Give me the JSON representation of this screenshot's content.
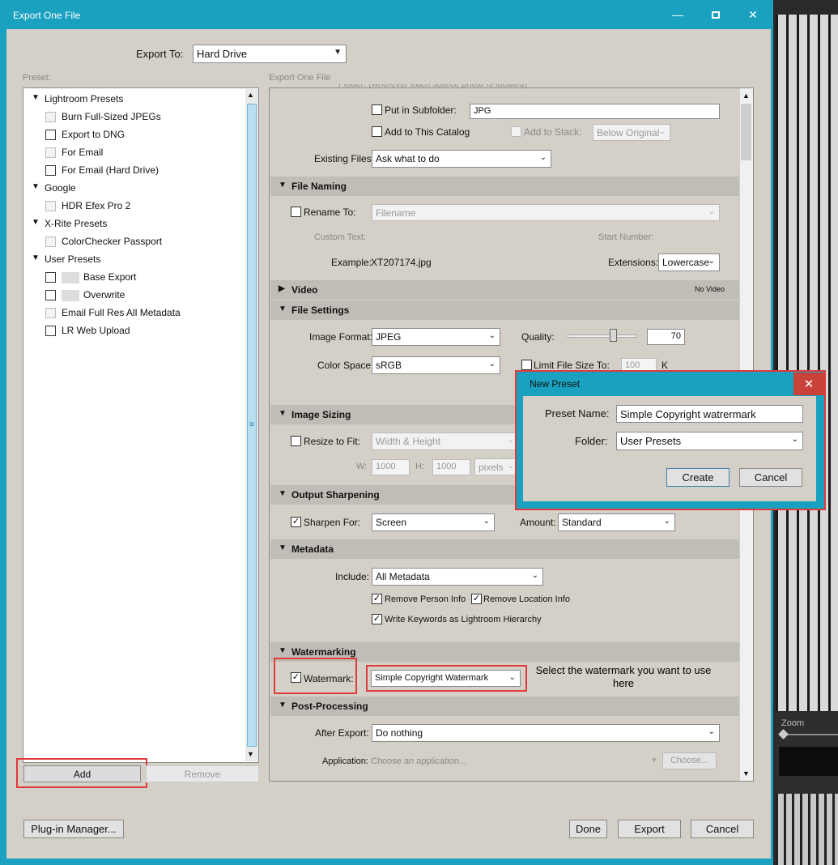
{
  "window": {
    "title": "Export One File"
  },
  "export_to": {
    "label": "Export To:",
    "value": "Hard Drive"
  },
  "preset": {
    "label": "Preset:"
  },
  "panel_title": "Export One File",
  "preset_tree": [
    {
      "folder": "Lightroom Presets",
      "items": [
        {
          "label": "Burn Full-Sized JPEGs",
          "enabled": false
        },
        {
          "label": "Export to DNG",
          "enabled": true
        },
        {
          "label": "For Email",
          "enabled": false
        },
        {
          "label": "For Email (Hard Drive)",
          "enabled": true
        }
      ]
    },
    {
      "folder": "Google",
      "items": [
        {
          "label": "HDR Efex Pro 2",
          "enabled": false
        }
      ]
    },
    {
      "folder": "X-Rite Presets",
      "items": [
        {
          "label": "ColorChecker Passport",
          "enabled": false
        }
      ]
    },
    {
      "folder": "User Presets",
      "items": [
        {
          "label": "Base Export",
          "enabled": true
        },
        {
          "label": "Overwrite",
          "enabled": true
        },
        {
          "label": "Email Full Res All Metadata",
          "enabled": false
        },
        {
          "label": "LR Web Upload",
          "enabled": true
        }
      ]
    }
  ],
  "left_buttons": {
    "add": "Add",
    "remove": "Remove"
  },
  "location": {
    "folder_cut": "Folder: (wherever each source photo is located)",
    "subfolder_label": "Put in Subfolder:",
    "subfolder_value": "JPG",
    "add_catalog": "Add to This Catalog",
    "add_stack": "Add to Stack:",
    "stack_value": "Below Original",
    "existing_label": "Existing Files:",
    "existing_value": "Ask what to do"
  },
  "file_naming": {
    "header": "File Naming",
    "rename_label": "Rename To:",
    "rename_value": "Filename",
    "custom_text": "Custom Text:",
    "start_number": "Start Number:",
    "example_label": "Example:",
    "example_value": "XT207174.jpg",
    "extensions_label": "Extensions:",
    "extensions_value": "Lowercase"
  },
  "video": {
    "header": "Video",
    "status": "No Video"
  },
  "file_settings": {
    "header": "File Settings",
    "format_label": "Image Format:",
    "format_value": "JPEG",
    "quality_label": "Quality:",
    "quality_value": "70",
    "quality_fraction": 0.7,
    "color_label": "Color Space:",
    "color_value": "sRGB",
    "limit_label": "Limit File Size To:",
    "limit_value": "100",
    "limit_unit": "K"
  },
  "image_sizing": {
    "header": "Image Sizing",
    "resize_label": "Resize to Fit:",
    "resize_value": "Width & Height",
    "w_label": "W:",
    "w_value": "1000",
    "h_label": "H:",
    "h_value": "1000",
    "unit_value": "pixels"
  },
  "output_sharpening": {
    "header": "Output Sharpening",
    "sharpen_label": "Sharpen For:",
    "sharpen_value": "Screen",
    "amount_label": "Amount:",
    "amount_value": "Standard"
  },
  "metadata": {
    "header": "Metadata",
    "include_label": "Include:",
    "include_value": "All Metadata",
    "remove_person": "Remove Person Info",
    "remove_location": "Remove Location Info",
    "write_keywords": "Write Keywords as Lightroom Hierarchy"
  },
  "watermarking": {
    "header": "Watermarking",
    "watermark_label": "Watermark:",
    "watermark_value": "Simple Copyright Watermark"
  },
  "post_processing": {
    "header": "Post-Processing",
    "after_label": "After Export:",
    "after_value": "Do nothing",
    "app_label": "Application:",
    "app_placeholder": "Choose an application...",
    "choose_button": "Choose..."
  },
  "annotation": "Select the watermark you want to use here",
  "bottom_buttons": {
    "plugin": "Plug-in Manager...",
    "done": "Done",
    "export": "Export",
    "cancel": "Cancel"
  },
  "new_preset": {
    "title": "New Preset",
    "name_label": "Preset Name:",
    "name_value": "Simple Copyright watrermark",
    "folder_label": "Folder:",
    "folder_value": "User Presets",
    "create": "Create",
    "cancel": "Cancel"
  },
  "zoom": {
    "label": "Zoom"
  },
  "icons": {
    "minimize": "minimize-icon",
    "maximize": "maximize-icon",
    "close": "close-icon",
    "expand": "triangle-down-icon",
    "collapse": "triangle-right-icon",
    "dropdown": "chevron-down-icon"
  }
}
